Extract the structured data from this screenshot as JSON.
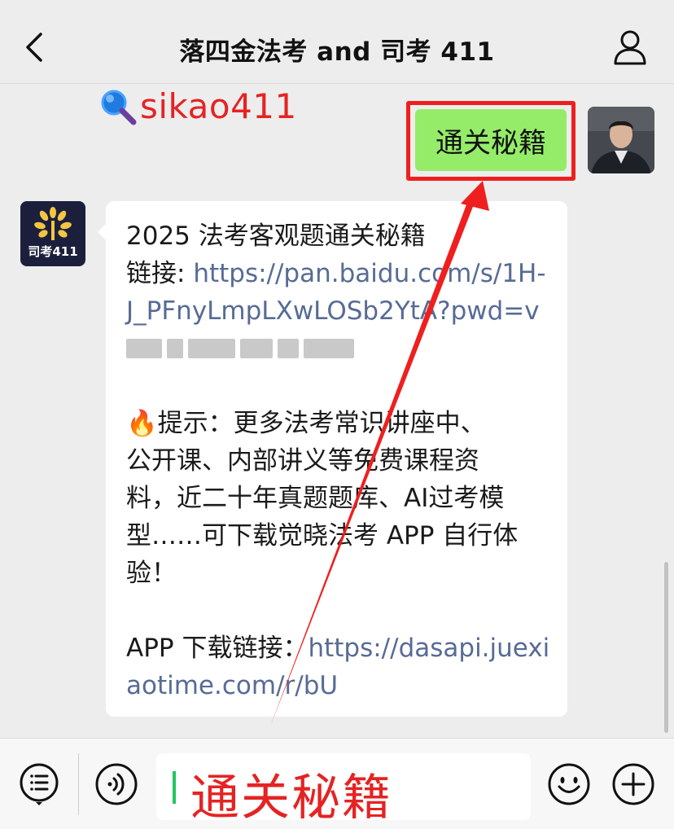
{
  "header": {
    "title": "落四金法考 and 司考 411",
    "back_icon": "chevron-left-icon",
    "profile_icon": "person-icon"
  },
  "overlay": {
    "search_tag": "sikao411",
    "search_icon": "magnifier-icon",
    "highlight_color": "#ef1f1f"
  },
  "messages": {
    "outgoing": {
      "text": "通关秘籍",
      "bubble_color": "#95ec69"
    },
    "incoming": {
      "avatar_label": "司考411",
      "lines": {
        "l1": "2025 法考客观题通关秘籍",
        "l2_prefix": "链接: ",
        "l2_link": "https://pan.baidu.com/s/1H-",
        "l3_link": "J_PFnyLmpLXwLOSb2YtA?pwd=v",
        "l5": "提示：更多法考常识讲座中、",
        "l5_icon": "🔥",
        "l6": "公开课、内部讲义等免费课程资",
        "l7": "料，近二十年真题题库、AI过考模",
        "l8": "型……可下载觉晓法考 APP 自行体",
        "l9": "验！",
        "l11_prefix": "APP 下载链接：",
        "l11_link": "https://dasapi.juexi",
        "l12_link": "aotime.com/r/bU"
      },
      "link_color": "#576b95"
    }
  },
  "input_bar": {
    "value": "通关秘籍",
    "menu_icon": "list-menu-icon",
    "voice_icon": "voice-icon",
    "emoji_icon": "smiley-icon",
    "plus_icon": "plus-icon"
  }
}
